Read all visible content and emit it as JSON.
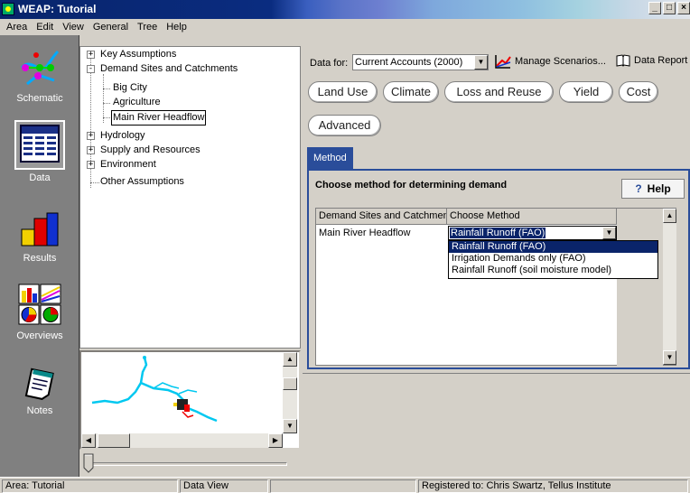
{
  "window": {
    "title": "WEAP: Tutorial"
  },
  "menu": [
    "Area",
    "Edit",
    "View",
    "General",
    "Tree",
    "Help"
  ],
  "toolbar": {
    "schematic": "Schematic",
    "data": "Data",
    "results": "Results",
    "overviews": "Overviews",
    "notes": "Notes"
  },
  "tree": {
    "key_assumptions": "Key Assumptions",
    "demand_sites": "Demand Sites and Catchments",
    "big_city": "Big City",
    "agriculture": "Agriculture",
    "main_river_headflow": "Main River Headflow",
    "hydrology": "Hydrology",
    "supply": "Supply and Resources",
    "environment": "Environment",
    "other": "Other Assumptions"
  },
  "top": {
    "data_for_label": "Data for:",
    "scenario": "Current Accounts (2000)",
    "manage_scenarios": "Manage Scenarios...",
    "data_report": "Data Report"
  },
  "categories": [
    "Land Use",
    "Climate",
    "Loss and Reuse",
    "Yield",
    "Cost",
    "Advanced"
  ],
  "method_tab": "Method",
  "panel": {
    "title": "Choose method for determining demand",
    "help": "Help"
  },
  "grid": {
    "col1": "Demand Sites and Catchments",
    "col2": "Choose Method",
    "row1_site": "Main River Headflow",
    "row1_method": "Rainfall Runoff (FAO)"
  },
  "dropdown_options": [
    "Rainfall Runoff (FAO)",
    "Irrigation Demands only (FAO)",
    "Rainfall Runoff (soil moisture model)"
  ],
  "status": {
    "area": "Area: Tutorial",
    "view": "Data View",
    "registered": "Registered to: Chris Swartz, Tellus Institute"
  },
  "colors": {
    "accent": "#2a4d9a",
    "title_dark": "#0a246a",
    "river": "#00c8f0"
  }
}
